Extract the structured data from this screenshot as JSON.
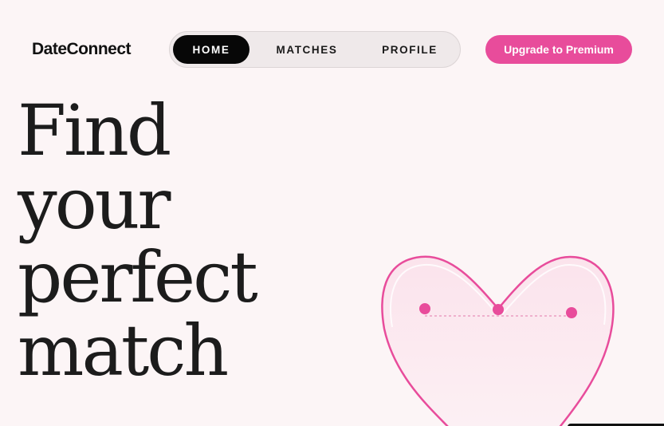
{
  "app": {
    "brand": "DateConnect"
  },
  "nav": {
    "items": [
      {
        "label": "HOME",
        "active": true
      },
      {
        "label": "MATCHES",
        "active": false
      },
      {
        "label": "PROFILE",
        "active": false
      }
    ]
  },
  "header": {
    "cta_label": "Upgrade to Premium"
  },
  "hero": {
    "lines": [
      "Find",
      "your",
      "perfect",
      "match"
    ]
  },
  "colors": {
    "accent": "#e84c9b",
    "background": "#fcf5f6",
    "heart_fill": "#fbe5ee",
    "nav_active": "#070707"
  },
  "icons": {
    "heart": "heart-illustration-icon"
  }
}
